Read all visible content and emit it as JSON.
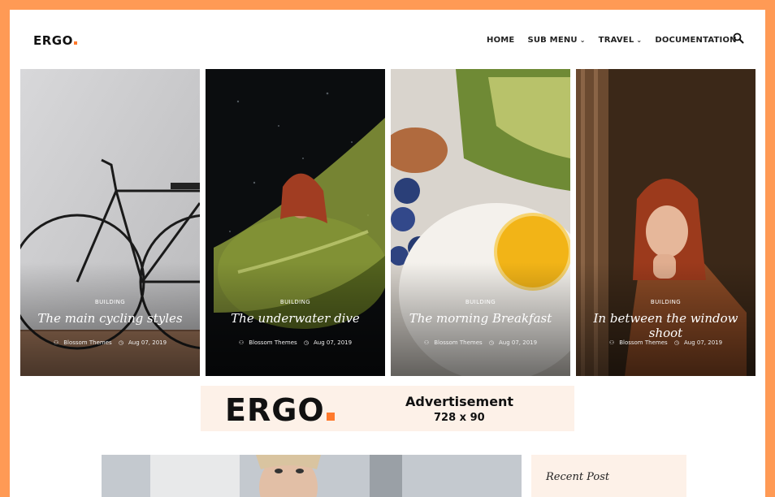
{
  "header": {
    "logo": "ERGO",
    "nav": [
      {
        "label": "HOME",
        "has_dropdown": false
      },
      {
        "label": "SUB MENU",
        "has_dropdown": true
      },
      {
        "label": "TRAVEL",
        "has_dropdown": true
      },
      {
        "label": "DOCUMENTATION",
        "has_dropdown": false
      }
    ],
    "search_icon": "search-icon"
  },
  "cards": [
    {
      "category": "BUILDING",
      "title": "The main cycling styles",
      "author": "Blossom Themes",
      "date": "Aug 07, 2019"
    },
    {
      "category": "BUILDING",
      "title": "The underwater dive",
      "author": "Blossom Themes",
      "date": "Aug 07, 2019"
    },
    {
      "category": "BUILDING",
      "title": "The morning Breakfast",
      "author": "Blossom Themes",
      "date": "Aug 07, 2019"
    },
    {
      "category": "BUILDING",
      "title": "In between the window shoot",
      "author": "Blossom Themes",
      "date": "Aug 07, 2019"
    }
  ],
  "ad": {
    "logo": "ERGO",
    "title": "Advertisement",
    "size": "728 x 90"
  },
  "sidebar": {
    "title": "Recent Post"
  },
  "colors": {
    "accent": "#ff7a2d",
    "frame": "#ff9a55",
    "ad_bg": "#fdf1e8"
  }
}
